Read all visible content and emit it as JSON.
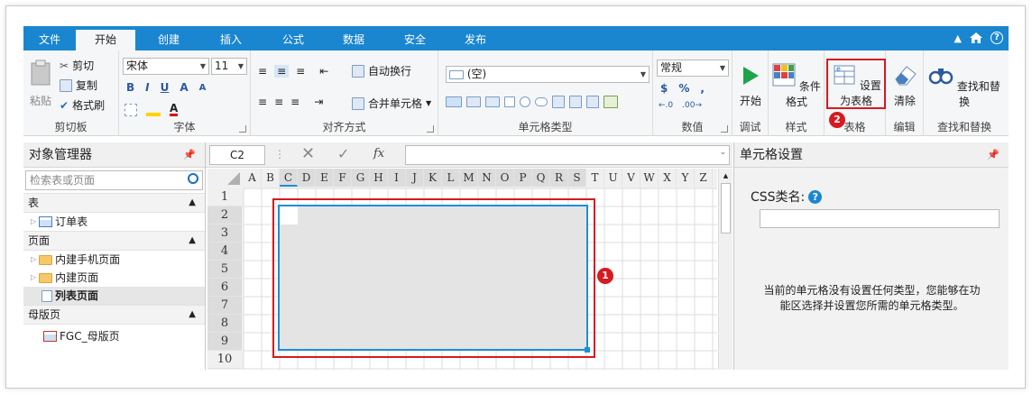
{
  "menubar": {
    "tabs": [
      "文件",
      "开始",
      "创建",
      "插入",
      "公式",
      "数据",
      "安全",
      "发布"
    ],
    "active": "开始",
    "color": "#1a86d0"
  },
  "ribbon": {
    "clipboard": {
      "paste": "粘贴",
      "cut": "剪切",
      "copy": "复制",
      "format_painter": "格式刷",
      "title": "剪切板"
    },
    "font": {
      "name": "宋体",
      "size": "11",
      "bold": "B",
      "italic": "I",
      "underline": "U",
      "grow": "A",
      "shrink": "A",
      "fill_label": "A",
      "title": "字体"
    },
    "align": {
      "wrap": "自动换行",
      "merge": "合并单元格",
      "title": "对齐方式"
    },
    "celltype": {
      "value": "(空)",
      "title": "单元格类型"
    },
    "number": {
      "format": "常规",
      "currency": "$",
      "percent": "%",
      "comma": ",",
      "title": "数值"
    },
    "debug": {
      "start": "开始",
      "title": "调试"
    },
    "style": {
      "cond": "条件格式",
      "title": "样式"
    },
    "table": {
      "set": "设置为表格",
      "title": "表格"
    },
    "edit": {
      "clear": "清除",
      "title": "编辑"
    },
    "find": {
      "label": "查找和替换",
      "title": "查找和替换"
    }
  },
  "objmgr": {
    "title": "对象管理器",
    "search_placeholder": "检索表或页面",
    "sections": {
      "tables": {
        "label": "表",
        "items": [
          "订单表"
        ]
      },
      "pages": {
        "label": "页面",
        "items": [
          "内建手机页面",
          "内建页面",
          "列表页面"
        ]
      },
      "masters": {
        "label": "母版页",
        "items": [
          "FGC_母版页"
        ]
      }
    }
  },
  "formula": {
    "cellref": "C2",
    "fx": "fx"
  },
  "grid": {
    "columns": [
      "A",
      "B",
      "C",
      "D",
      "E",
      "F",
      "G",
      "H",
      "I",
      "J",
      "K",
      "L",
      "M",
      "N",
      "O",
      "P",
      "Q",
      "R",
      "S",
      "T",
      "U",
      "V",
      "W",
      "X",
      "Y",
      "Z"
    ],
    "rows": [
      "1",
      "2",
      "3",
      "4",
      "5",
      "6",
      "7",
      "8",
      "9",
      "10"
    ]
  },
  "cellsettings": {
    "title": "单元格设置",
    "css_label": "CSS类名:",
    "info_line1": "当前的单元格没有设置任何类型，您能够在功",
    "info_line2": "能区选择并设置您所需的单元格类型。"
  },
  "badges": {
    "one": "1",
    "two": "2"
  },
  "colors": {
    "accent": "#1a86d0",
    "highlight": "#d71920",
    "selection": "#1b8fd8"
  }
}
